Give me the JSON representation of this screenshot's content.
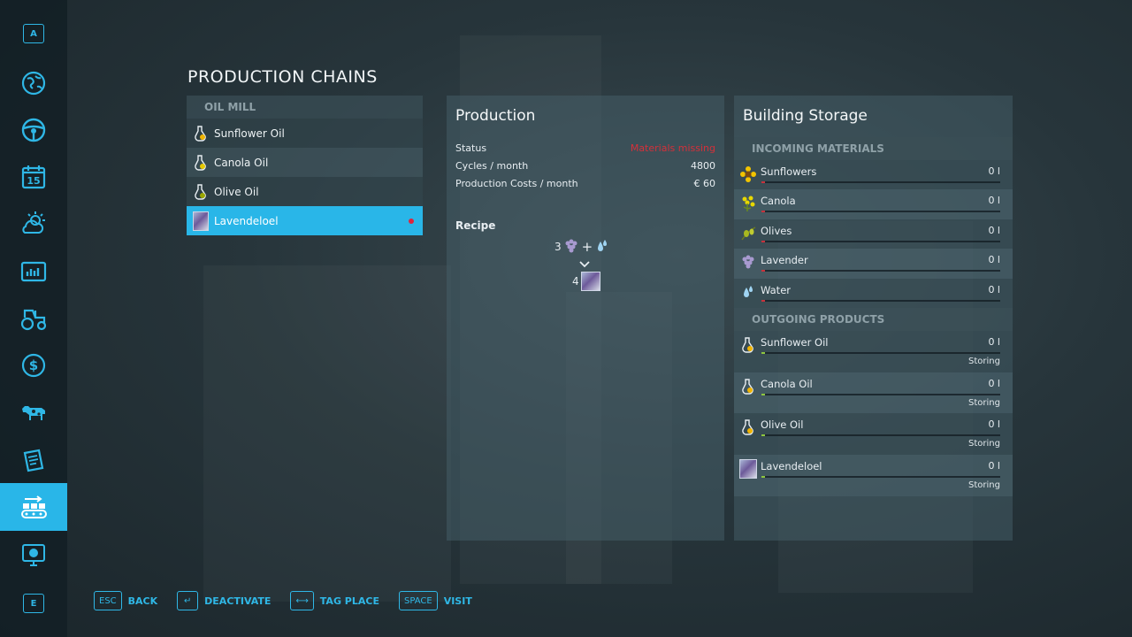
{
  "sidebar": {
    "top_key": "A",
    "bottom_key": "E",
    "icons": [
      "map-icon",
      "steering-wheel-icon",
      "calendar-icon",
      "weather-icon",
      "stats-icon",
      "tractor-icon",
      "money-icon",
      "animals-icon",
      "contracts-icon",
      "production-icon",
      "help-icon"
    ],
    "calendar_day": "15",
    "active": "production-icon",
    "accent": "#29b6e8"
  },
  "title": "PRODUCTION CHAINS",
  "chains": {
    "group": "OIL MILL",
    "items": [
      {
        "label": "Sunflower Oil",
        "icon": "oil-bottle-icon"
      },
      {
        "label": "Canola Oil",
        "icon": "oil-bottle-icon"
      },
      {
        "label": "Olive Oil",
        "icon": "oil-bottle-icon"
      },
      {
        "label": "Lavendeloel",
        "icon": "lavender-oil-icon",
        "selected": true,
        "warning": true
      }
    ]
  },
  "production": {
    "title": "Production",
    "status_label": "Status",
    "status_value": "Materials missing",
    "cycles_label": "Cycles / month",
    "cycles_value": "4800",
    "costs_label": "Production Costs / month",
    "costs_value": "€ 60",
    "recipe_label": "Recipe",
    "recipe_input_count": "3",
    "recipe_plus": "+",
    "recipe_output_count": "4"
  },
  "storage": {
    "title": "Building Storage",
    "incoming_label": "INCOMING MATERIALS",
    "incoming": [
      {
        "name": "Sunflowers",
        "amount": "0 l",
        "icon": "sunflower-icon"
      },
      {
        "name": "Canola",
        "amount": "0 l",
        "icon": "canola-icon"
      },
      {
        "name": "Olives",
        "amount": "0 l",
        "icon": "olives-icon"
      },
      {
        "name": "Lavender",
        "amount": "0 l",
        "icon": "lavender-icon"
      },
      {
        "name": "Water",
        "amount": "0 l",
        "icon": "water-drop-icon"
      }
    ],
    "outgoing_label": "OUTGOING PRODUCTS",
    "outgoing": [
      {
        "name": "Sunflower Oil",
        "amount": "0 l",
        "state": "Storing",
        "icon": "oil-bottle-icon"
      },
      {
        "name": "Canola Oil",
        "amount": "0 l",
        "state": "Storing",
        "icon": "oil-bottle-icon"
      },
      {
        "name": "Olive Oil",
        "amount": "0 l",
        "state": "Storing",
        "icon": "oil-bottle-icon"
      },
      {
        "name": "Lavendeloel",
        "amount": "0 l",
        "state": "Storing",
        "icon": "lavender-oil-icon"
      }
    ],
    "incoming_bar_color": "#c8323c",
    "outgoing_bar_color": "#8ec63f"
  },
  "footer": [
    {
      "key": "ESC",
      "label": "BACK"
    },
    {
      "key": "↵",
      "label": "DEACTIVATE"
    },
    {
      "key": "⟷",
      "label": "TAG PLACE"
    },
    {
      "key": "SPACE",
      "label": "VISIT"
    }
  ]
}
